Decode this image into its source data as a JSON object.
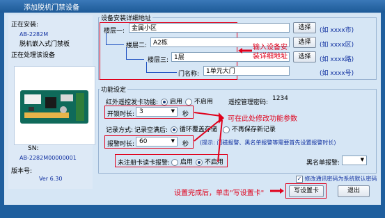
{
  "window": {
    "title": "添加脱机门禁设备"
  },
  "sidebar": {
    "installing_label": "正在安装:",
    "model": "AB-2282M",
    "model_desc": "脱机嵌入式门禁板",
    "processing_label": "正在处理该设备",
    "sn_label": "SN:",
    "sn_value": "AB-2282M00000001",
    "version_label": "版本号:",
    "version_value": "Ver 6.30"
  },
  "address": {
    "group_title": "设备安装详细地址",
    "floor1_label": "楼层一:",
    "floor1_value": "金属小区",
    "floor2_label": "楼层二:",
    "floor2_value": "A2栋",
    "floor3_label": "楼层三:",
    "floor3_value": "1层",
    "door_label": "门名称:",
    "door_value": "1单元大门",
    "select_label": "选择",
    "hint1": "(如 xxxx市)",
    "hint2": "(如 xxxx区)",
    "hint3": "(如 xxxx路)",
    "hint4": "(如 xxxx号)",
    "annotation": "输入设备安装详细地址"
  },
  "function": {
    "group_title": "功能设定",
    "ir_label": "红外遥控发卡功能:",
    "on_label": "启用",
    "off_label": "不启用",
    "remote_pwd_label": "遥控管理密码:",
    "remote_pwd_value": "1234",
    "open_time_label": "开锁时长:",
    "open_time_value": "3",
    "seconds": "秒",
    "record_label": "记录方式:",
    "record_full_label": "记录空满后:",
    "record_loop": "循环覆盖存储",
    "record_stop": "不再保存新记录",
    "alarm_time_label": "报警时长:",
    "alarm_time_value": "60",
    "tip": "(提示: 门磁报警、黑名单报警等需要首先设置报警时长)",
    "unreg_label": "未注册卡读卡报警:",
    "blacklist_label": "黑名单报警:",
    "annotation": "可在此处修改功能参数",
    "default_pwd_label": "修改通讯密码为系统默认密码"
  },
  "footer": {
    "hint": "设置完成后，单击\"写设置卡\"",
    "write_button": "写设置卡",
    "exit_button": "退出"
  },
  "colors": {
    "accent_red": "#e0001b",
    "title_blue": "#1f5f9e"
  }
}
